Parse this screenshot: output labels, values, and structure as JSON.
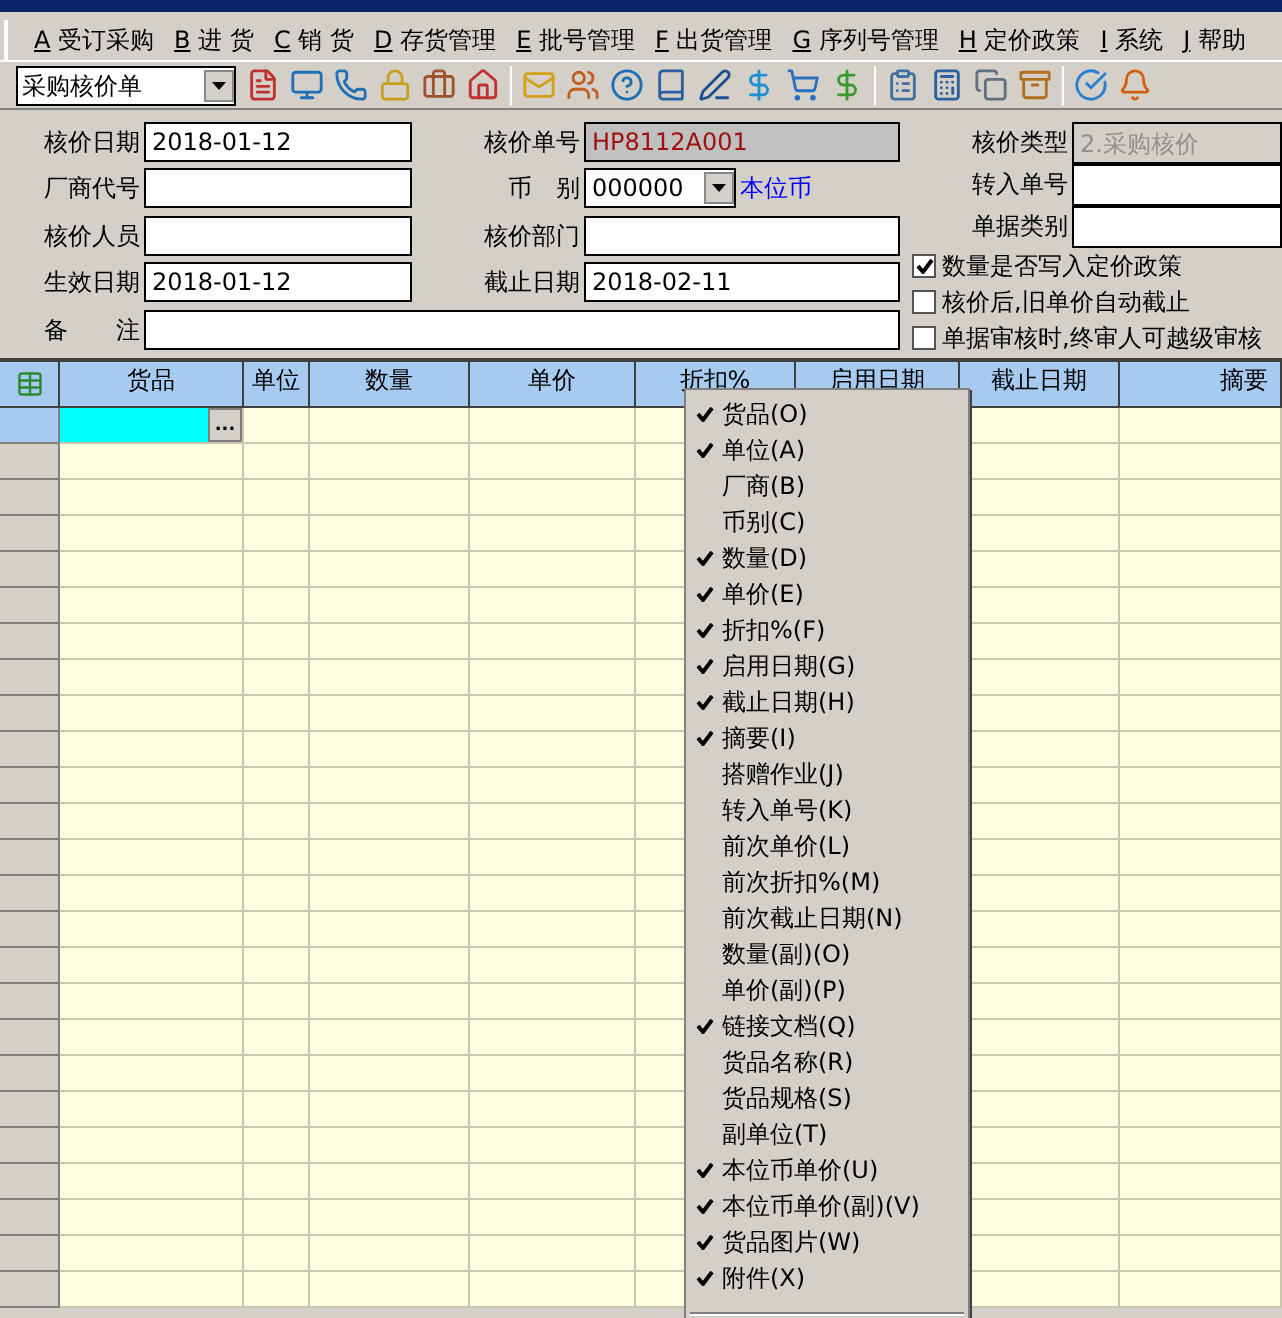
{
  "menu_bar": [
    {
      "key": "A",
      "label": "受订采购"
    },
    {
      "key": "B",
      "label": "进 货"
    },
    {
      "key": "C",
      "label": "销 货"
    },
    {
      "key": "D",
      "label": "存货管理"
    },
    {
      "key": "E",
      "label": "批号管理"
    },
    {
      "key": "F",
      "label": "出货管理"
    },
    {
      "key": "G",
      "label": "序列号管理"
    },
    {
      "key": "H",
      "label": "定价政策"
    },
    {
      "key": "I",
      "label": "系统"
    },
    {
      "key": "J",
      "label": "帮助"
    }
  ],
  "toolbar": {
    "document_type": "采购核价单"
  },
  "form": {
    "rows": [
      {
        "label": "核价日期",
        "value": "2018-01-12",
        "mid": {
          "kind": "readonly",
          "label": "核价单号",
          "value": "HP8112A001"
        }
      },
      {
        "label": "厂商代号",
        "mid": {
          "kind": "select",
          "label": "币　别",
          "value": "000000",
          "link": "本位币"
        }
      },
      {
        "label": "核价人员",
        "mid": {
          "kind": "text",
          "label": "核价部门"
        }
      },
      {
        "label": "生效日期",
        "value": "2018-01-12",
        "mid": {
          "kind": "text",
          "label": "截止日期",
          "value": "2018-02-11"
        }
      }
    ],
    "remark_label": "备　　注",
    "right_fields": [
      {
        "label": "核价类型",
        "value": "2.采购核价",
        "disabled": true
      },
      {
        "label": "转入单号",
        "disabled": false
      },
      {
        "label": "单据类别",
        "disabled": false
      }
    ],
    "options": [
      {
        "label": "数量是否写入定价政策",
        "checked": true
      },
      {
        "label": "核价后,旧单价自动截止",
        "checked": false
      },
      {
        "label": "单据审核时,终审人可越级审核",
        "checked": false
      }
    ]
  },
  "grid": {
    "columns": [
      "货品",
      "单位",
      "数量",
      "单价",
      "折扣%",
      "启用日期",
      "截止日期",
      "摘要"
    ],
    "cell_button": "..."
  },
  "column_menu": [
    {
      "label": "货品(O)",
      "checked": true
    },
    {
      "label": "单位(A)",
      "checked": true
    },
    {
      "label": "厂商(B)",
      "checked": false
    },
    {
      "label": "币别(C)",
      "checked": false
    },
    {
      "label": "数量(D)",
      "checked": true
    },
    {
      "label": "单价(E)",
      "checked": true
    },
    {
      "label": "折扣%(F)",
      "checked": true
    },
    {
      "label": "启用日期(G)",
      "checked": true
    },
    {
      "label": "截止日期(H)",
      "checked": true
    },
    {
      "label": "摘要(I)",
      "checked": true
    },
    {
      "label": "搭赠作业(J)",
      "checked": false
    },
    {
      "label": "转入单号(K)",
      "checked": false
    },
    {
      "label": "前次单价(L)",
      "checked": false
    },
    {
      "label": "前次折扣%(M)",
      "checked": false
    },
    {
      "label": "前次截止日期(N)",
      "checked": false
    },
    {
      "label": "数量(副)(O)",
      "checked": false
    },
    {
      "label": "单价(副)(P)",
      "checked": false
    },
    {
      "label": "链接文档(Q)",
      "checked": true
    },
    {
      "label": "货品名称(R)",
      "checked": false
    },
    {
      "label": "货品规格(S)",
      "checked": false
    },
    {
      "label": "副单位(T)",
      "checked": false
    },
    {
      "label": "本位币单价(U)",
      "checked": true
    },
    {
      "label": "本位币单价(副)(V)",
      "checked": true
    },
    {
      "label": "货品图片(W)",
      "checked": true
    },
    {
      "label": "附件(X)",
      "checked": true
    }
  ]
}
